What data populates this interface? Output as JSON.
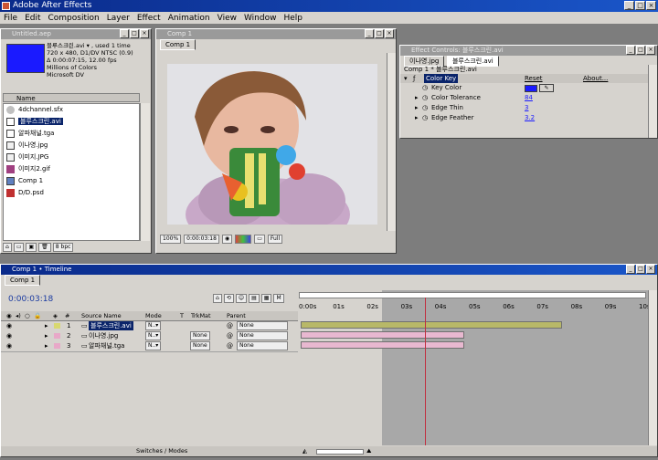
{
  "app": {
    "title": "Adobe After Effects"
  },
  "colors": {
    "titlebar": "#0a2a8a",
    "chrome": "#d6d3ce",
    "comp_bg": "#e2e2e6",
    "key_color": "#1a1aff",
    "playhead": "#c03040"
  },
  "menu": [
    "File",
    "Edit",
    "Composition",
    "Layer",
    "Effect",
    "Animation",
    "View",
    "Window",
    "Help"
  ],
  "project": {
    "title": "Untitled.aep",
    "info_line1": "블루스크린.avi ▾ , used 1 time",
    "info_line2": "720 x 480, D1/DV NTSC (0.9)",
    "info_line3": "Δ 0:00:07:15, 12.00 fps",
    "info_line4": "Millions of Colors",
    "info_line5": "Microsoft DV",
    "column_name": "Name",
    "items": [
      {
        "name": "4dchannel.sfx",
        "icon": "file-icon"
      },
      {
        "name": "블루스크린.avi",
        "icon": "footage-icon",
        "selected": true
      },
      {
        "name": "알파채널.tga",
        "icon": "footage-icon"
      },
      {
        "name": "이나영.jpg",
        "icon": "image-icon"
      },
      {
        "name": "이미지.JPG",
        "icon": "image-icon"
      },
      {
        "name": "이미지2.gif",
        "icon": "image-icon"
      },
      {
        "name": "Comp 1",
        "icon": "comp-icon"
      },
      {
        "name": "D/D.psd",
        "icon": "psd-icon"
      }
    ],
    "bpc": "8 bpc"
  },
  "comp": {
    "title": "Comp 1",
    "tab": "Comp 1",
    "zoom": "100%",
    "timecode": "0:00:03:18",
    "resolution": "Full"
  },
  "effects": {
    "title": "Effect Controls: 블루스크린.avi",
    "tab1": "이나영.jpg",
    "tab2": "블루스크린.avi",
    "breadcrumb": "Comp 1 * 블루스크린.avi",
    "effect_name": "Color Key",
    "reset": "Reset",
    "about": "About...",
    "params": [
      {
        "label": "Key Color",
        "value": ""
      },
      {
        "label": "Color Tolerance",
        "value": "84"
      },
      {
        "label": "Edge Thin",
        "value": "3"
      },
      {
        "label": "Edge Feather",
        "value": "3.2"
      }
    ]
  },
  "timeline": {
    "title": "Comp 1 • Timeline",
    "tab": "Comp 1",
    "timecode": "0:00:03:18",
    "col_source": "Source Name",
    "col_mode": "Mode",
    "col_t": "T",
    "col_trkmat": "TrkMat",
    "col_parent": "Parent",
    "ruler": [
      "0:00s",
      "01s",
      "02s",
      "03s",
      "04s",
      "05s",
      "06s",
      "07s",
      "08s",
      "09s",
      "10s"
    ],
    "playhead_value": 3.65,
    "work_area_end": 2.4,
    "layers": [
      {
        "num": "1",
        "name": "블루스크린.avi",
        "mode": "N..▾",
        "trkmat": "",
        "parent": "None",
        "color": "#d8d870",
        "bar_start": 0,
        "bar_end": 7.7,
        "bar_color": "#b8b868"
      },
      {
        "num": "2",
        "name": "이나영.jpg",
        "mode": "N..▾",
        "trkmat": "None",
        "parent": "None",
        "color": "#e8a8c8",
        "bar_start": 0,
        "bar_end": 4.8,
        "bar_color": "#e8b8d0"
      },
      {
        "num": "3",
        "name": "알파채널.tga",
        "mode": "N..▾",
        "trkmat": "None",
        "parent": "None",
        "color": "#e8a8c8",
        "bar_start": 0,
        "bar_end": 4.8,
        "bar_color": "#e8b8d0"
      }
    ],
    "footer": "Switches / Modes"
  }
}
